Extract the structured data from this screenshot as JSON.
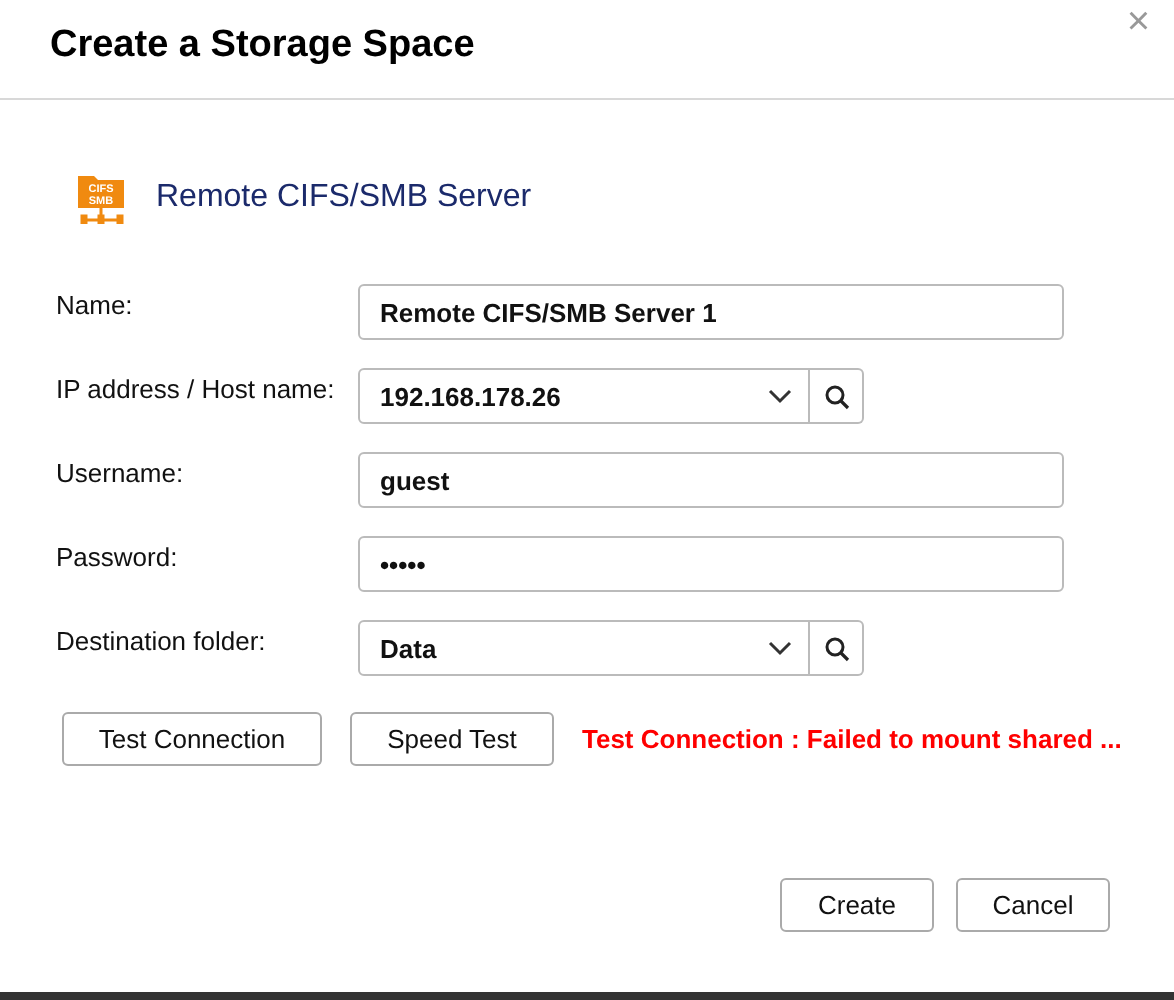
{
  "window": {
    "title": "Create a Storage Space",
    "close": "×"
  },
  "server": {
    "label": "Remote CIFS/SMB Server",
    "icon_text": [
      "CIFS",
      "SMB"
    ]
  },
  "fields": [
    {
      "kind": "text",
      "label": "Name:",
      "value": "Remote CIFS/SMB Server 1"
    },
    {
      "kind": "combo",
      "label": "IP address / Host name:",
      "value": "192.168.178.26"
    },
    {
      "kind": "text",
      "label": "Username:",
      "value": "guest"
    },
    {
      "kind": "text",
      "label": "Password:",
      "value": "•••••"
    },
    {
      "kind": "combo",
      "label": "Destination folder:",
      "value": "Data"
    }
  ],
  "test_buttons": [
    "Test Connection",
    "Speed Test"
  ],
  "error_message": "Test Connection : Failed to mount shared ...",
  "buttons": [
    "Create",
    "Cancel"
  ]
}
